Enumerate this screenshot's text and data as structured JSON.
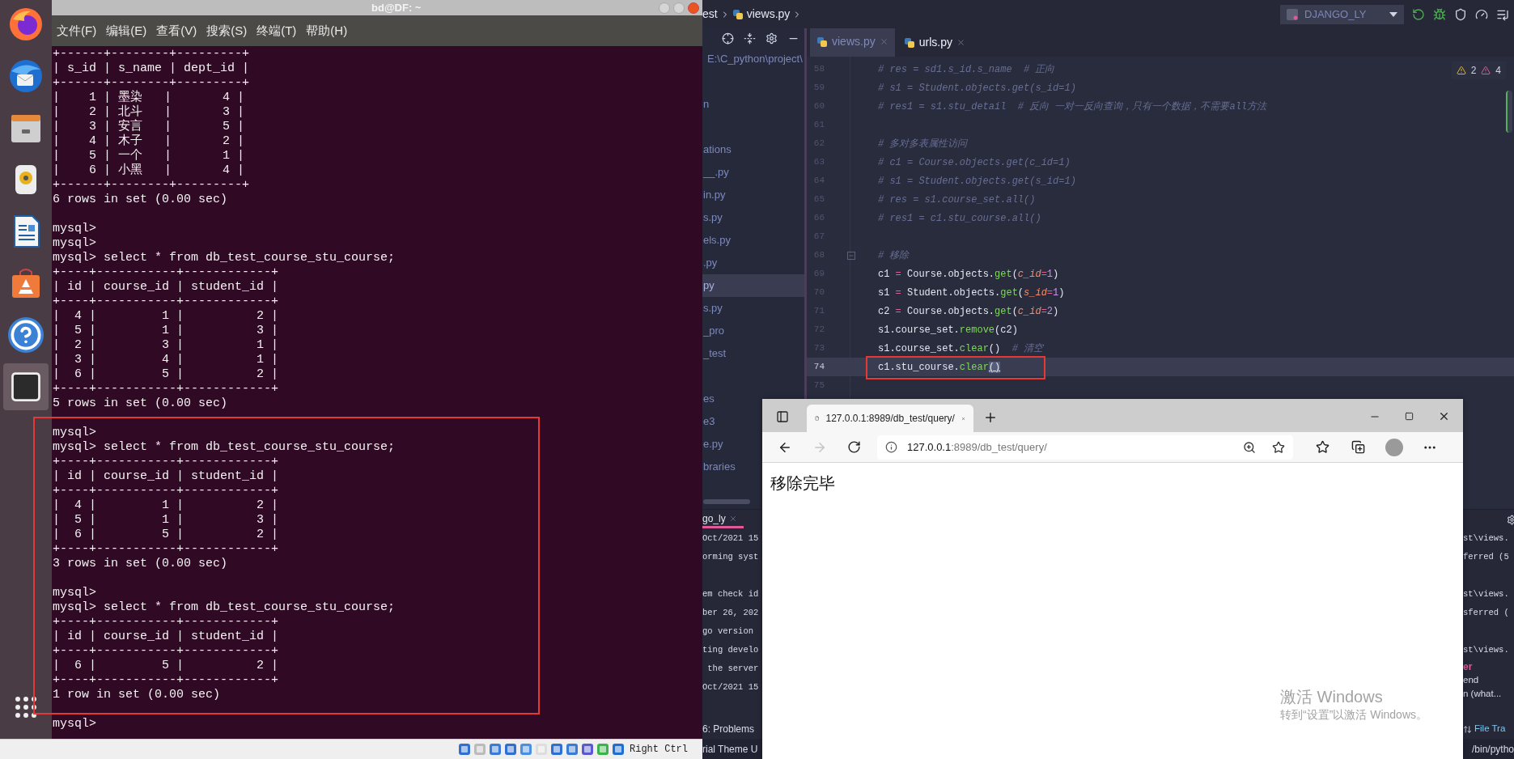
{
  "vm": {
    "window_title": "bd@DF: ~",
    "menu": [
      "文件(F)",
      "编辑(E)",
      "查看(V)",
      "搜索(S)",
      "终端(T)",
      "帮助(H)"
    ],
    "dock": [
      {
        "kind": "firefox",
        "selected": false
      },
      {
        "kind": "mail",
        "selected": false
      },
      {
        "kind": "files",
        "selected": false
      },
      {
        "kind": "music",
        "selected": false
      },
      {
        "kind": "writer",
        "selected": false
      },
      {
        "kind": "store",
        "selected": false
      },
      {
        "kind": "help",
        "selected": false
      },
      {
        "kind": "terminal",
        "selected": true
      },
      {
        "kind": "apps",
        "selected": false
      }
    ],
    "terminal_blocks": [
      [
        "+------+--------+---------+",
        "| s_id | s_name | dept_id |",
        "+------+--------+---------+",
        "|    1 | 墨染   |       4 |",
        "|    2 | 北斗   |       3 |",
        "|    3 | 安言   |       5 |",
        "|    4 | 木子   |       2 |",
        "|    5 | 一个   |       1 |",
        "|    6 | 小黑   |       4 |",
        "+------+--------+---------+",
        "6 rows in set (0.00 sec)"
      ],
      [
        "mysql>",
        "mysql>",
        "mysql> select * from db_test_course_stu_course;",
        "+----+-----------+------------+",
        "| id | course_id | student_id |",
        "+----+-----------+------------+",
        "|  4 |         1 |          2 |",
        "|  5 |         1 |          3 |",
        "|  2 |         3 |          1 |",
        "|  3 |         4 |          1 |",
        "|  6 |         5 |          2 |",
        "+----+-----------+------------+",
        "5 rows in set (0.00 sec)"
      ],
      [
        "mysql>",
        "mysql> select * from db_test_course_stu_course;",
        "+----+-----------+------------+",
        "| id | course_id | student_id |",
        "+----+-----------+------------+",
        "|  4 |         1 |          2 |",
        "|  5 |         1 |          3 |",
        "|  6 |         5 |          2 |",
        "+----+-----------+------------+",
        "3 rows in set (0.00 sec)"
      ],
      [
        "mysql>",
        "mysql> select * from db_test_course_stu_course;",
        "+----+-----------+------------+",
        "| id | course_id | student_id |",
        "+----+-----------+------------+",
        "|  6 |         5 |          2 |",
        "+----+-----------+------------+",
        "1 row in set (0.00 sec)"
      ],
      [
        "mysql>"
      ]
    ],
    "host_key": "Right Ctrl"
  },
  "ide": {
    "breadcrumb": [
      "est",
      "views.py"
    ],
    "run_config": "DJANGO_LY",
    "project_path": "E:\\C_python\\project\\",
    "tree_groups": [
      [
        {
          "label": "n",
          "selected": false
        }
      ],
      [
        {
          "label": "ations",
          "selected": false
        },
        {
          "label": "__.py",
          "selected": false
        },
        {
          "label": "in.py",
          "selected": false
        },
        {
          "label": "s.py",
          "selected": false
        },
        {
          "label": "els.py",
          "selected": false
        },
        {
          "label": ".py",
          "selected": false
        },
        {
          "label": "py",
          "selected": true
        },
        {
          "label": "s.py",
          "selected": false
        },
        {
          "label": "_pro",
          "selected": false
        },
        {
          "label": "_test",
          "selected": false
        }
      ],
      [
        {
          "label": "es",
          "selected": false
        },
        {
          "label": "e3",
          "selected": false
        },
        {
          "label": "e.py",
          "selected": false
        },
        {
          "label": "braries",
          "selected": false
        }
      ]
    ],
    "tabs": [
      {
        "label": "views.py",
        "selected": true
      },
      {
        "label": "urls.py",
        "selected": false
      }
    ],
    "inspections": {
      "warnings": "2",
      "errors": "4"
    },
    "code_lines": [
      {
        "number": "58",
        "current": false,
        "tokens": [
          {
            "kind": "comment",
            "text": "# res = sd1.s_id.s_name  # 正向"
          }
        ]
      },
      {
        "number": "59",
        "current": false,
        "tokens": [
          {
            "kind": "comment",
            "text": "# s1 = Student.objects.get(s_id=1)"
          }
        ]
      },
      {
        "number": "60",
        "current": false,
        "tokens": [
          {
            "kind": "comment",
            "text": "# res1 = s1.stu_detail  # 反向 一对一反向查询，只有一个数据，不需要all方法"
          }
        ]
      },
      {
        "number": "61",
        "current": false
      },
      {
        "number": "62",
        "current": false,
        "tokens": [
          {
            "kind": "comment",
            "text": "# 多对多表属性访问"
          }
        ]
      },
      {
        "number": "63",
        "current": false,
        "tokens": [
          {
            "kind": "comment",
            "text": "# c1 = Course.objects.get(c_id=1)"
          }
        ]
      },
      {
        "number": "64",
        "current": false,
        "tokens": [
          {
            "kind": "comment",
            "text": "# s1 = Student.objects.get(s_id=1)"
          }
        ]
      },
      {
        "number": "65",
        "current": false,
        "tokens": [
          {
            "kind": "comment",
            "text": "# res = s1.course_set.all()"
          }
        ]
      },
      {
        "number": "66",
        "current": false,
        "tokens": [
          {
            "kind": "comment",
            "text": "# res1 = c1.stu_course.all()"
          }
        ]
      },
      {
        "number": "67",
        "current": false
      },
      {
        "number": "68",
        "current": false,
        "fold": true,
        "tokens": [
          {
            "kind": "comment",
            "text": "# 移除"
          }
        ]
      },
      {
        "number": "69",
        "current": false,
        "tokens": [
          {
            "kind": "plain",
            "text": "c1 "
          },
          {
            "kind": "op",
            "text": "="
          },
          {
            "kind": "plain",
            "text": " Course.objects."
          },
          {
            "kind": "method",
            "text": "get"
          },
          {
            "kind": "plain",
            "text": "("
          },
          {
            "kind": "param",
            "text": "c_id"
          },
          {
            "kind": "op",
            "text": "="
          },
          {
            "kind": "number",
            "text": "1"
          },
          {
            "kind": "plain",
            "text": ")"
          }
        ]
      },
      {
        "number": "70",
        "current": false,
        "tokens": [
          {
            "kind": "plain",
            "text": "s1 "
          },
          {
            "kind": "op",
            "text": "="
          },
          {
            "kind": "plain",
            "text": " Student.objects."
          },
          {
            "kind": "method",
            "text": "get"
          },
          {
            "kind": "plain",
            "text": "("
          },
          {
            "kind": "param",
            "text": "s_id"
          },
          {
            "kind": "op",
            "text": "="
          },
          {
            "kind": "number",
            "text": "1"
          },
          {
            "kind": "plain",
            "text": ")"
          }
        ]
      },
      {
        "number": "71",
        "current": false,
        "tokens": [
          {
            "kind": "plain",
            "text": "c2 "
          },
          {
            "kind": "op",
            "text": "="
          },
          {
            "kind": "plain",
            "text": " Course.objects."
          },
          {
            "kind": "method",
            "text": "get"
          },
          {
            "kind": "plain",
            "text": "("
          },
          {
            "kind": "param",
            "text": "c_id"
          },
          {
            "kind": "op",
            "text": "="
          },
          {
            "kind": "number",
            "text": "2"
          },
          {
            "kind": "plain",
            "text": ")"
          }
        ]
      },
      {
        "number": "72",
        "current": false,
        "tokens": [
          {
            "kind": "plain",
            "text": "s1.course_set."
          },
          {
            "kind": "method",
            "text": "remove"
          },
          {
            "kind": "plain",
            "text": "(c2)"
          }
        ]
      },
      {
        "number": "73",
        "current": false,
        "tokens": [
          {
            "kind": "plain",
            "text": "s1.course_set."
          },
          {
            "kind": "method",
            "text": "clear"
          },
          {
            "kind": "plain",
            "text": "()  "
          },
          {
            "kind": "comment",
            "text": "# 清空"
          }
        ]
      },
      {
        "number": "74",
        "current": true,
        "tokens": [
          {
            "kind": "plain",
            "text": "c1.stu_course."
          },
          {
            "kind": "method",
            "text": "clear"
          },
          {
            "kind": "brace",
            "text": "()"
          }
        ]
      },
      {
        "number": "75",
        "current": false
      }
    ],
    "run_tab": "go_ly",
    "console_left": [
      [
        "Oct/2021 15",
        "orming syst"
      ],
      [
        "em check id",
        "ber 26, 202",
        "go version",
        "ting develo",
        " the server",
        "Oct/2021 15"
      ]
    ],
    "console_right": [
      [
        {
          "kind": "path",
          "text": "st\\views."
        },
        {
          "kind": "path",
          "text": "ferred (5"
        }
      ],
      [
        {
          "kind": "path",
          "text": "st\\views."
        },
        {
          "kind": "path",
          "text": "sferred ("
        }
      ],
      [
        {
          "kind": "path",
          "text": "st\\views."
        },
        {
          "kind": "error",
          "text": "er"
        },
        {
          "kind": "note",
          "text": "end"
        },
        {
          "kind": "note",
          "text": "n (what..."
        }
      ]
    ],
    "tool_window": "6: Problems",
    "right_tool": "File Tra",
    "status_left": "rial Theme U",
    "status_right": "/bin/pytho"
  },
  "browser": {
    "tab_title": "127.0.0.1:8989/db_test/query/",
    "url_host": "127.0.0.1",
    "url_rest": ":8989/db_test/query/",
    "page_text": "移除完毕"
  },
  "os_notice": {
    "title": "激活 Windows",
    "body": "转到“设置”以激活 Windows。"
  }
}
